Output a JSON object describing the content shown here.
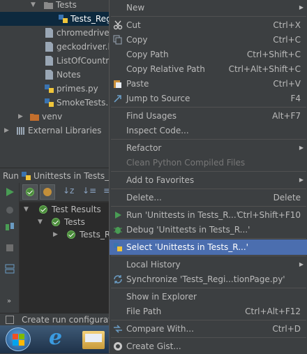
{
  "project_tree": {
    "items": [
      {
        "label": "Tests",
        "kind": "folder"
      },
      {
        "label": "Tests_Regi",
        "kind": "python"
      },
      {
        "label": "chromedriver.",
        "kind": "file"
      },
      {
        "label": "geckodriver.lo",
        "kind": "file"
      },
      {
        "label": "ListOfCountrie",
        "kind": "file"
      },
      {
        "label": "Notes",
        "kind": "file"
      },
      {
        "label": "primes.py",
        "kind": "python"
      },
      {
        "label": "SmokeTests.p",
        "kind": "python"
      },
      {
        "label": "venv",
        "kind": "folder"
      },
      {
        "label": "External Libraries",
        "kind": "library"
      }
    ]
  },
  "run_panel": {
    "header": "Run",
    "config": "Unittests in Tests_Re",
    "results": [
      {
        "label": "Test Results"
      },
      {
        "label": "Tests"
      },
      {
        "label": "Tests_R"
      }
    ]
  },
  "status_bar": {
    "text": "Create run configuratio"
  },
  "taskbar": {
    "icons": [
      "windows-start-icon",
      "internet-explorer-icon",
      "file-explorer-icon"
    ]
  },
  "context_menu": {
    "items": [
      {
        "label": "New",
        "shortcut": "",
        "submenu": true
      },
      {
        "label": "Cut",
        "shortcut": "Ctrl+X",
        "icon": "scissors-icon"
      },
      {
        "label": "Copy",
        "shortcut": "Ctrl+C",
        "icon": "copy-icon"
      },
      {
        "label": "Copy Path",
        "shortcut": "Ctrl+Shift+C"
      },
      {
        "label": "Copy Relative Path",
        "shortcut": "Ctrl+Alt+Shift+C"
      },
      {
        "label": "Paste",
        "shortcut": "Ctrl+V",
        "icon": "paste-icon"
      },
      {
        "label": "Jump to Source",
        "shortcut": "F4",
        "icon": "jump-icon"
      },
      {
        "label": "Find Usages",
        "shortcut": "Alt+F7"
      },
      {
        "label": "Inspect Code...",
        "shortcut": ""
      },
      {
        "label": "Refactor",
        "shortcut": "",
        "submenu": true
      },
      {
        "label": "Clean Python Compiled Files",
        "shortcut": "",
        "disabled": true
      },
      {
        "label": "Add to Favorites",
        "shortcut": "",
        "submenu": true
      },
      {
        "label": "Delete...",
        "shortcut": "Delete"
      },
      {
        "label": "Run 'Unittests in Tests_R...'",
        "shortcut": "Ctrl+Shift+F10",
        "icon": "run-icon"
      },
      {
        "label": "Debug 'Unittests in Tests_R...'",
        "shortcut": "",
        "icon": "debug-icon"
      },
      {
        "label": "Select 'Unittests in Tests_R...'",
        "shortcut": "",
        "icon": "python-icon",
        "highlighted": true
      },
      {
        "label": "Local History",
        "shortcut": "",
        "submenu": true
      },
      {
        "label": "Synchronize 'Tests_Regi...tionPage.py'",
        "shortcut": "",
        "icon": "sync-icon"
      },
      {
        "label": "Show in Explorer",
        "shortcut": ""
      },
      {
        "label": "File Path",
        "shortcut": "Ctrl+Alt+F12"
      },
      {
        "label": "Compare With...",
        "shortcut": "Ctrl+D",
        "icon": "compare-icon"
      },
      {
        "label": "Create Gist...",
        "shortcut": "",
        "icon": "github-icon"
      }
    ]
  },
  "colors": {
    "highlight": "#4b6eaf",
    "background": "#3c3f41",
    "run_green": "#499c54"
  }
}
